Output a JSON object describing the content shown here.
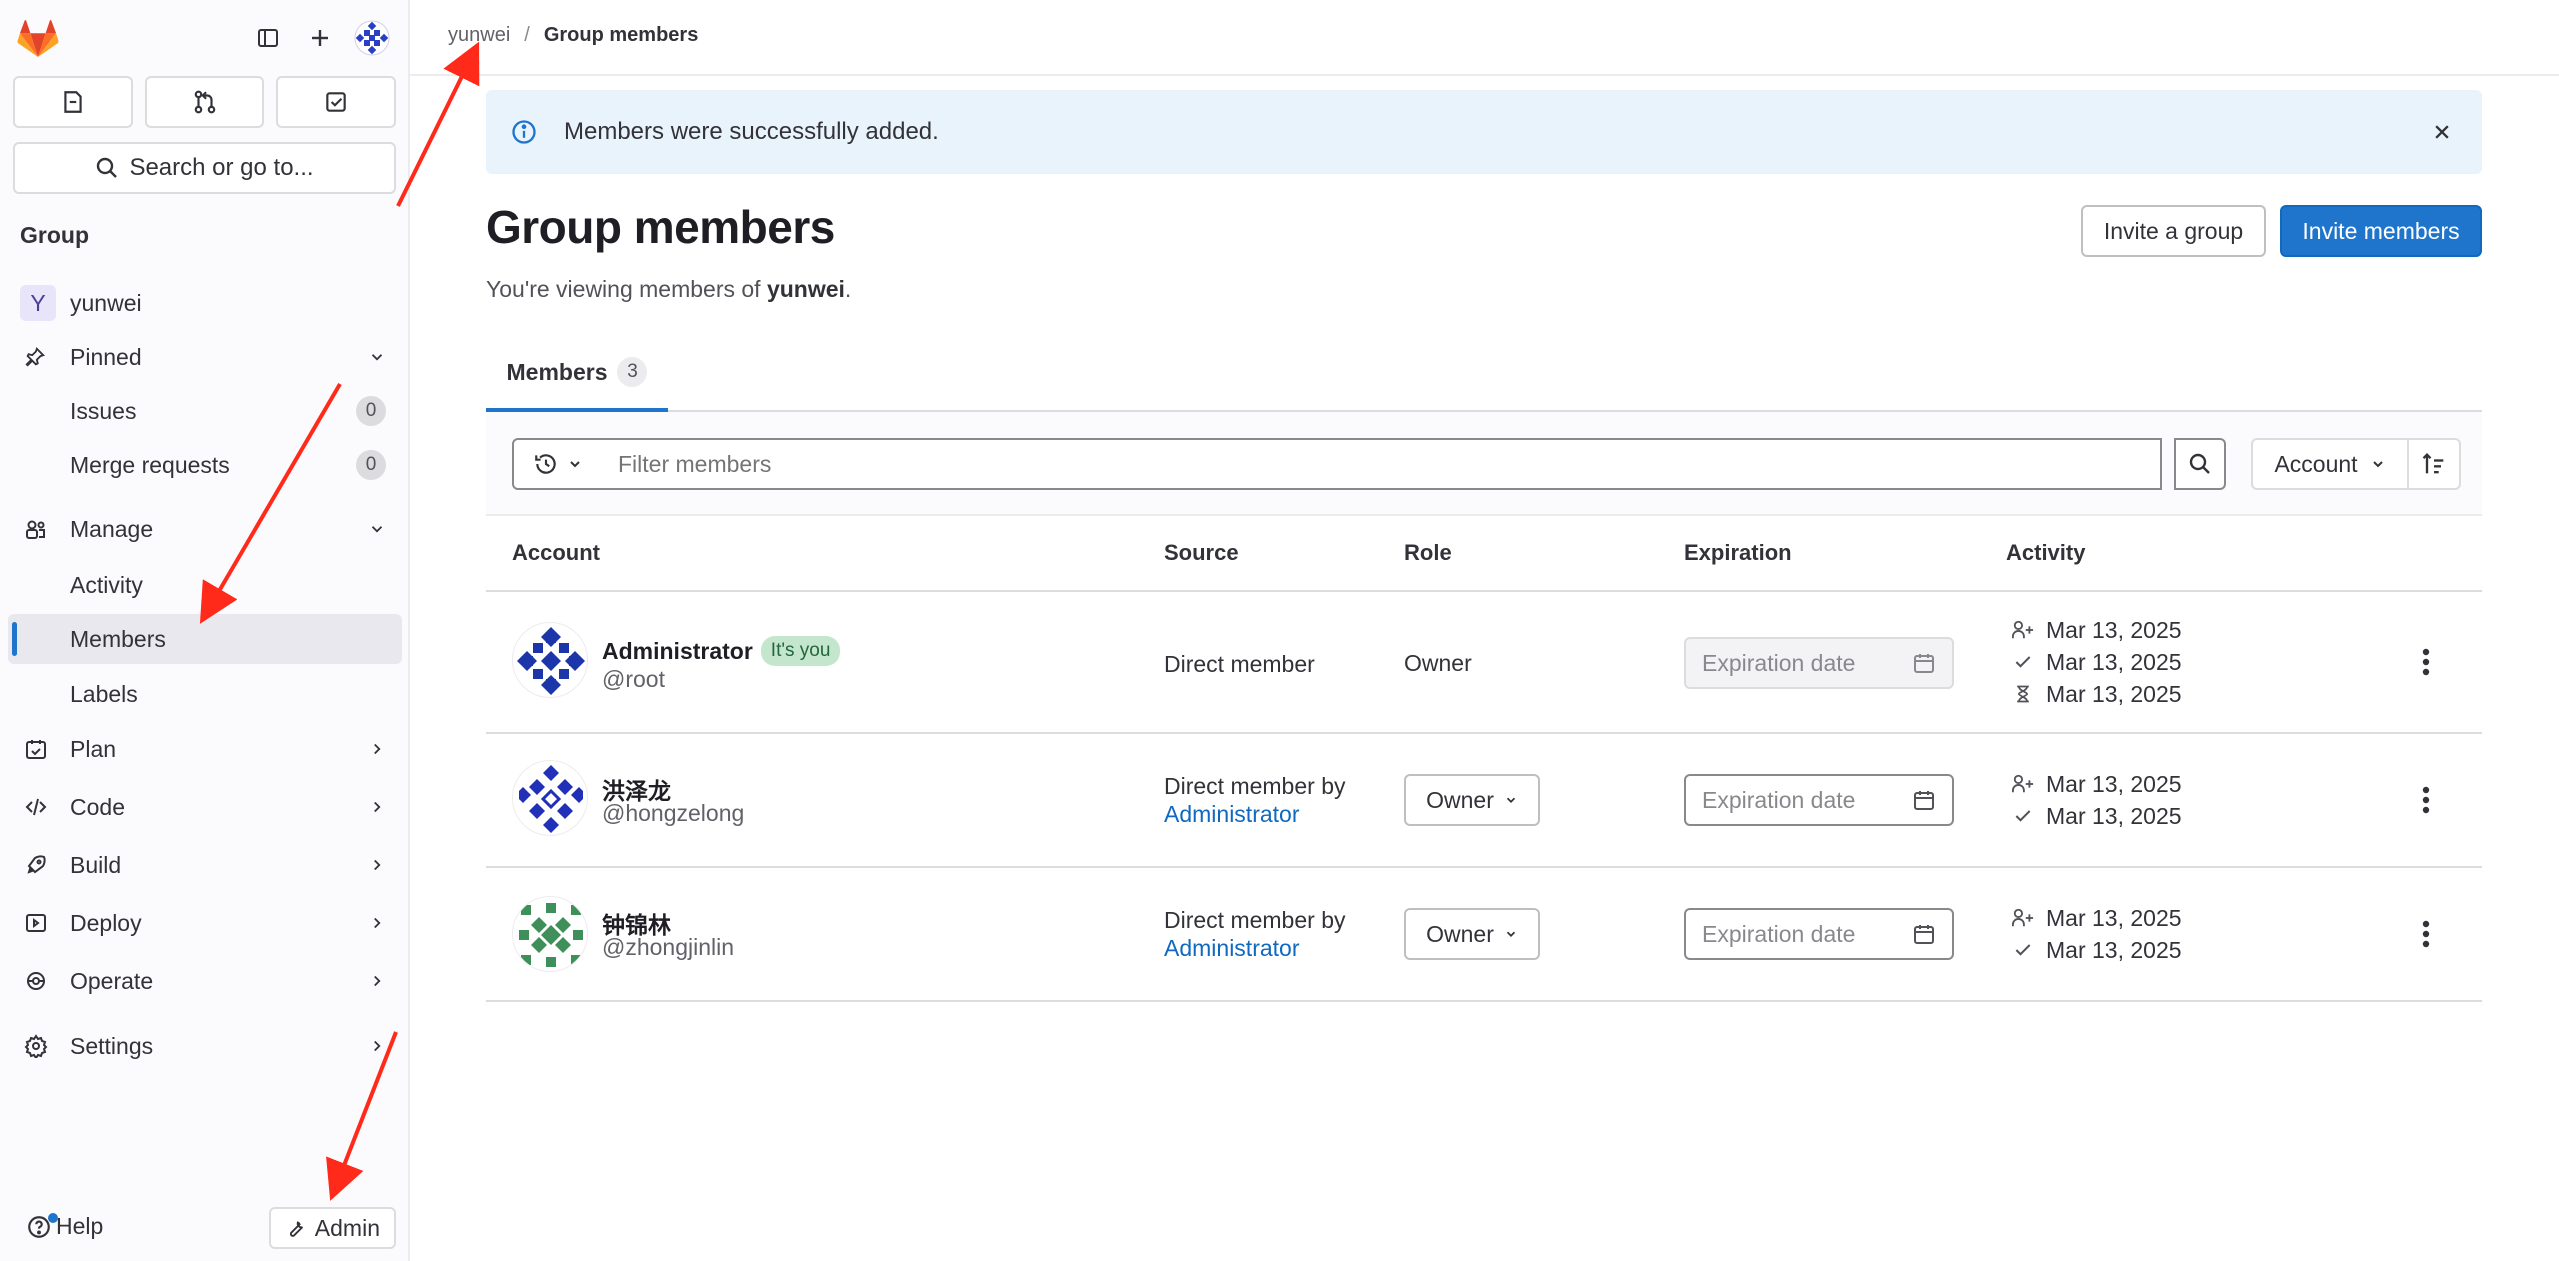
{
  "sidebar": {
    "search_label": "Search or go to...",
    "section_title": "Group",
    "group_initial": "Y",
    "group_name": "yunwei",
    "pinned": {
      "label": "Pinned",
      "items": [
        {
          "label": "Issues",
          "count": "0"
        },
        {
          "label": "Merge requests",
          "count": "0"
        }
      ]
    },
    "manage": {
      "label": "Manage",
      "items": [
        {
          "label": "Activity"
        },
        {
          "label": "Members"
        },
        {
          "label": "Labels"
        }
      ]
    },
    "plan": "Plan",
    "code": "Code",
    "build": "Build",
    "deploy": "Deploy",
    "operate": "Operate",
    "settings": "Settings",
    "help": "Help",
    "admin": "Admin"
  },
  "breadcrumb": {
    "parent": "yunwei",
    "separator": "/",
    "current": "Group members"
  },
  "alert": {
    "message": "Members were successfully added."
  },
  "page": {
    "title": "Group members",
    "subtitle_prefix": "You're viewing members of ",
    "subtitle_group": "yunwei",
    "subtitle_suffix": ".",
    "invite_group": "Invite a group",
    "invite_members": "Invite members"
  },
  "tabs": [
    {
      "label": "Members",
      "count": "3"
    }
  ],
  "filter": {
    "placeholder": "Filter members",
    "sort_label": "Account"
  },
  "table": {
    "headers": {
      "account": "Account",
      "source": "Source",
      "role": "Role",
      "expiration": "Expiration",
      "activity": "Activity"
    },
    "expiration_placeholder": "Expiration date",
    "rows": [
      {
        "name": "Administrator",
        "badge": "It's you",
        "handle": "@root",
        "source": "Direct member",
        "source_by": "",
        "role": "Owner",
        "role_editable": false,
        "activity": {
          "joined": "Mar 13, 2025",
          "signed_in": "Mar 13, 2025",
          "last_activity": "Mar 13, 2025"
        }
      },
      {
        "name": "洪泽龙",
        "badge": "",
        "handle": "@hongzelong",
        "source": "Direct member by",
        "source_by": "Administrator",
        "role": "Owner",
        "role_editable": true,
        "activity": {
          "joined": "Mar 13, 2025",
          "signed_in": "Mar 13, 2025"
        }
      },
      {
        "name": "钟锦林",
        "badge": "",
        "handle": "@zhongjinlin",
        "source": "Direct member by",
        "source_by": "Administrator",
        "role": "Owner",
        "role_editable": true,
        "activity": {
          "joined": "Mar 13, 2025",
          "signed_in": "Mar 13, 2025"
        }
      }
    ]
  },
  "colors": {
    "primary": "#1f75cb",
    "link": "#1068bf",
    "alert_bg": "#e9f3fc",
    "annotation": "#ff2a1a"
  }
}
